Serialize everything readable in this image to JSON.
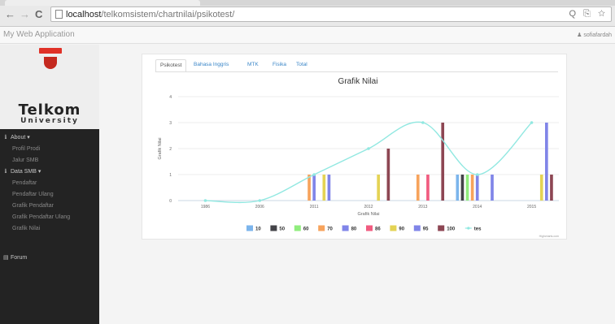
{
  "browser": {
    "back_icon": "back-arrow-icon",
    "forward_icon": "forward-arrow-icon",
    "reload_icon": "reload-icon",
    "url_host": "localhost",
    "url_path": "/telkomsistem/chartnilai/psikotest/",
    "tools": "Q ⎘ ☆"
  },
  "app": {
    "brand": "My Web Application",
    "user": "♟ sofiafardah"
  },
  "logo": {
    "line1": "Telkom",
    "line2": "University",
    "colors": {
      "red": "#e03127",
      "dark_red": "#c4291f"
    }
  },
  "sidebar": {
    "items": [
      {
        "label": "About ▾",
        "icon": "info-icon",
        "glyph": "ℹ",
        "kind": "top"
      },
      {
        "label": "Profil Prodi",
        "kind": "sub"
      },
      {
        "label": "Jalur SMB",
        "kind": "sub"
      },
      {
        "label": "Data SMB ▾",
        "icon": "info-icon",
        "glyph": "ℹ",
        "kind": "top"
      },
      {
        "label": "Pendaftar",
        "kind": "sub"
      },
      {
        "label": "Pendaftar Ulang",
        "kind": "sub"
      },
      {
        "label": "Grafik Pendaftar",
        "kind": "sub"
      },
      {
        "label": "Grafik Pendaftar Ulang",
        "kind": "sub"
      },
      {
        "label": "Grafik Nilai",
        "kind": "sub"
      },
      {
        "label": "Forum",
        "icon": "document-icon",
        "glyph": "▤",
        "kind": "top"
      }
    ]
  },
  "tabs": [
    {
      "label": "Psikotest",
      "active": true
    },
    {
      "label": "Bahasa Inggris",
      "active": false
    },
    {
      "label": "MTK",
      "active": false
    },
    {
      "label": "Fisika",
      "active": false
    },
    {
      "label": "Total",
      "active": false
    }
  ],
  "chart_data": {
    "type": "bar",
    "title": "Grafik Nilai",
    "xlabel": "Grafik Nilai",
    "ylabel": "Grafik Nilai",
    "credit": "Highcharts.com",
    "categories": [
      "1986",
      "2006",
      "2011",
      "2012",
      "2013",
      "2014",
      "2015"
    ],
    "ylim": [
      0,
      4
    ],
    "yticks": [
      0,
      1,
      2,
      3,
      4
    ],
    "grid": true,
    "legend_position": "bottom",
    "series": [
      {
        "name": "10",
        "color": "#7cb5ec",
        "values": [
          null,
          null,
          null,
          null,
          null,
          1,
          null
        ]
      },
      {
        "name": "50",
        "color": "#434348",
        "values": [
          null,
          null,
          null,
          null,
          null,
          1,
          null
        ]
      },
      {
        "name": "60",
        "color": "#90ed7d",
        "values": [
          null,
          null,
          null,
          null,
          null,
          1,
          null
        ]
      },
      {
        "name": "70",
        "color": "#f7a35c",
        "values": [
          null,
          null,
          1,
          null,
          1,
          1,
          null
        ]
      },
      {
        "name": "80",
        "color": "#8085e9",
        "values": [
          null,
          null,
          1,
          null,
          null,
          1,
          null
        ]
      },
      {
        "name": "86",
        "color": "#f15c80",
        "values": [
          null,
          null,
          null,
          null,
          1,
          null,
          null
        ]
      },
      {
        "name": "90",
        "color": "#e4d354",
        "values": [
          null,
          null,
          1,
          1,
          null,
          null,
          1
        ]
      },
      {
        "name": "95",
        "color": "#8085e8",
        "values": [
          null,
          null,
          1,
          null,
          null,
          1,
          3
        ]
      },
      {
        "name": "100",
        "color": "#8d4653",
        "values": [
          null,
          null,
          null,
          2,
          3,
          null,
          1
        ]
      },
      {
        "name": "tes",
        "color": "#91e8e1",
        "type": "spline",
        "values": [
          0,
          0,
          1,
          2,
          3,
          1,
          3
        ]
      }
    ]
  }
}
